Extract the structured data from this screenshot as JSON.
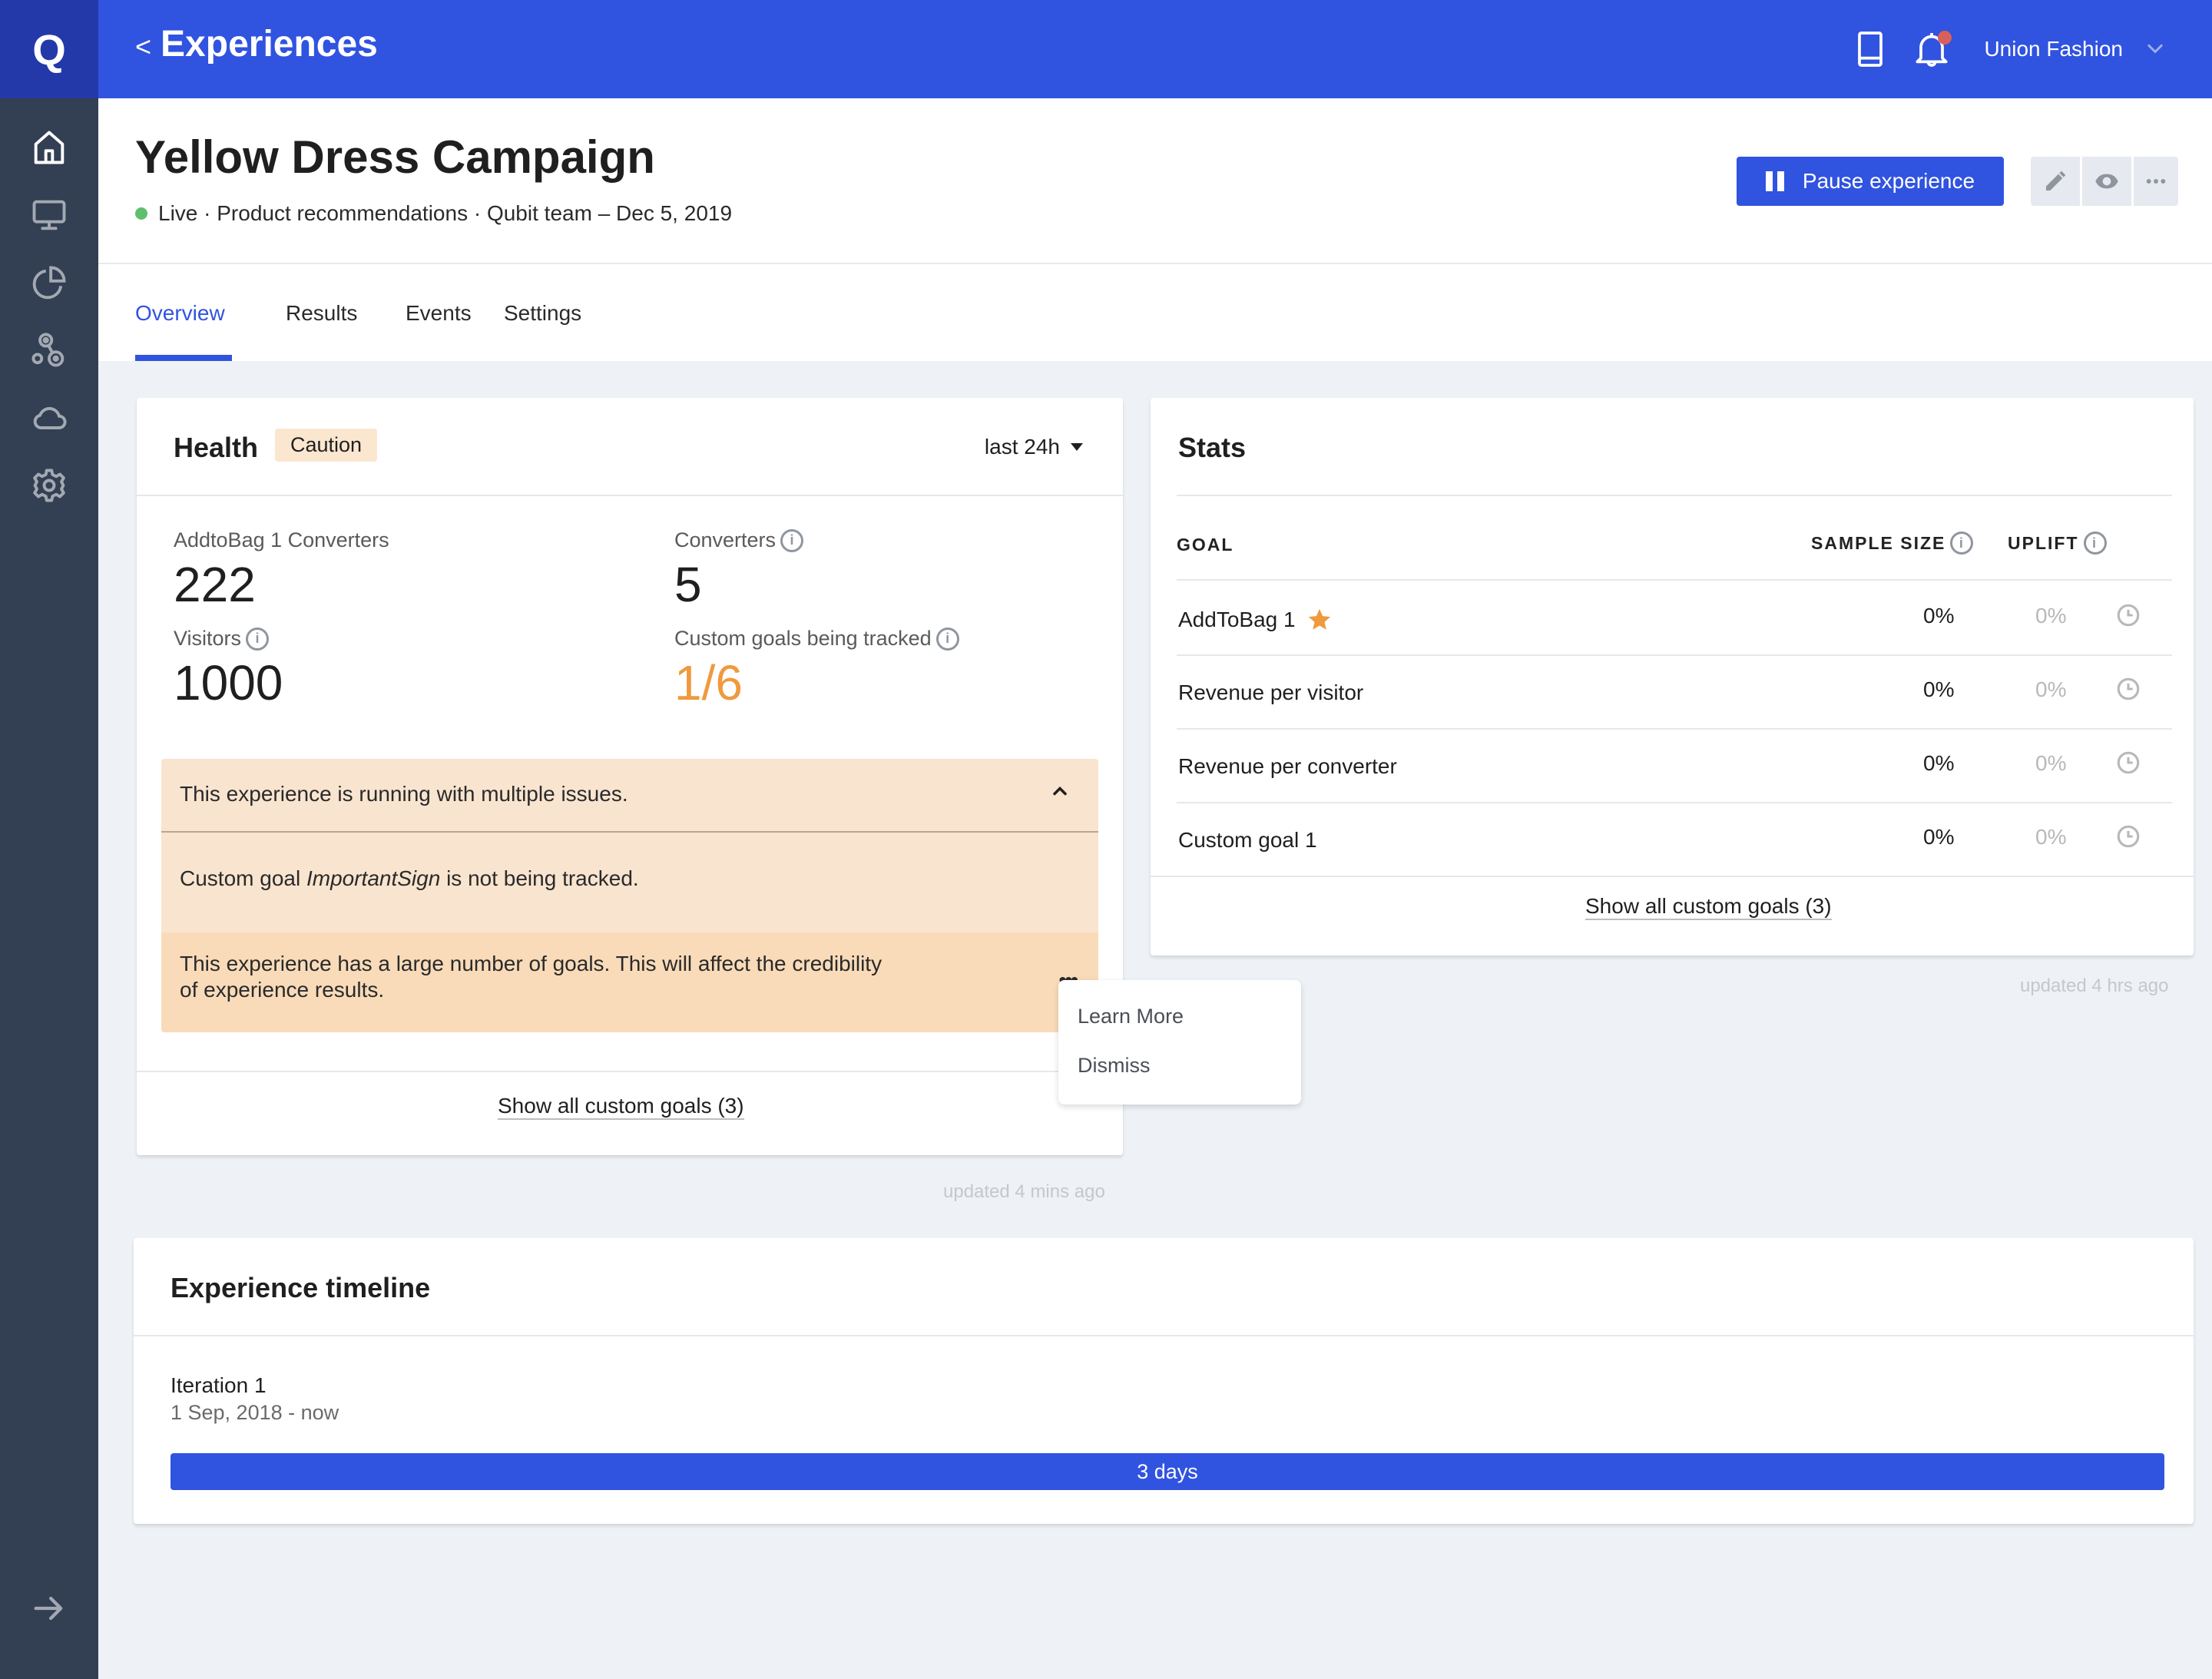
{
  "app": {
    "logo": "Q",
    "back_label": "<",
    "section_title": "Experiences",
    "account_name": "Union Fashion",
    "notification_dot_color": "#d9605a",
    "brand_color": "#3053e0"
  },
  "sidebar": {
    "items": [
      {
        "icon": "home-icon",
        "active": true
      },
      {
        "icon": "monitor-icon",
        "active": false
      },
      {
        "icon": "pie-chart-icon",
        "active": false
      },
      {
        "icon": "segments-icon",
        "active": false
      },
      {
        "icon": "cloud-icon",
        "active": false
      },
      {
        "icon": "gear-icon",
        "active": false
      }
    ],
    "expand_icon": "arrow-right-icon"
  },
  "experience": {
    "title": "Yellow Dress Campaign",
    "status": "Live",
    "status_color": "#5fbf6e",
    "meta": "Live · Product recommendations · Qubit team – Dec 5, 2019",
    "pause_label": "Pause experience",
    "actions": [
      "pencil-icon",
      "eye-icon",
      "more-icon"
    ]
  },
  "tabs": [
    {
      "label": "Overview",
      "active": true
    },
    {
      "label": "Results",
      "active": false
    },
    {
      "label": "Events",
      "active": false
    },
    {
      "label": "Settings",
      "active": false
    }
  ],
  "health": {
    "title": "Health",
    "badge": "Caution",
    "badge_color": "#fbe6cf",
    "range": "last 24h",
    "metrics": [
      {
        "label": "AddtoBag 1 Converters",
        "value": "222",
        "info": false
      },
      {
        "label": "Converters",
        "value": "5",
        "info": true
      },
      {
        "label": "Visitors",
        "value": "1000",
        "info": true
      },
      {
        "label": "Custom goals being tracked",
        "value": "1/6",
        "info": true,
        "color": "#ef9a3d"
      }
    ],
    "alert_summary": "This experience is running with multiple issues.",
    "alerts": [
      {
        "prefix": "Custom goal ",
        "emphasis": "ImportantSign",
        "suffix": " is not being tracked."
      },
      {
        "text": "This experience has a large number of goals. This will affect the credibility of experience results."
      }
    ],
    "alert_menu": [
      "Learn More",
      "Dismiss"
    ],
    "show_all_label": "Show all custom goals (3)",
    "updated": "updated 4 mins ago"
  },
  "stats": {
    "title": "Stats",
    "columns": [
      "GOAL",
      "SAMPLE SIZE",
      "UPLIFT"
    ],
    "rows": [
      {
        "goal": "AddToBag 1",
        "starred": true,
        "sample_size": "0%",
        "uplift": "0%"
      },
      {
        "goal": "Revenue per visitor",
        "starred": false,
        "sample_size": "0%",
        "uplift": "0%"
      },
      {
        "goal": "Revenue per converter",
        "starred": false,
        "sample_size": "0%",
        "uplift": "0%"
      },
      {
        "goal": "Custom goal 1",
        "starred": false,
        "sample_size": "0%",
        "uplift": "0%"
      }
    ],
    "show_all_label": "Show all custom goals (3)",
    "updated": "updated 4 hrs ago"
  },
  "timeline": {
    "title": "Experience timeline",
    "iterations": [
      {
        "name": "Iteration 1",
        "range": "1 Sep, 2018 - now",
        "duration": "3 days"
      }
    ]
  }
}
